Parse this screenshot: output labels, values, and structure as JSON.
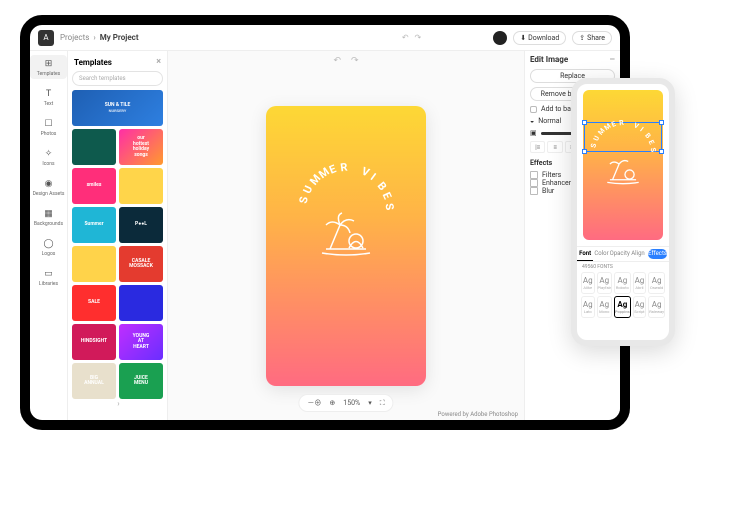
{
  "breadcrumb": {
    "root": "Projects",
    "current": "My Project"
  },
  "toolbar": {
    "download": "Download",
    "share": "Share"
  },
  "rail": [
    {
      "label": "Templates",
      "icon": "⊞",
      "active": true
    },
    {
      "label": "Text",
      "icon": "T"
    },
    {
      "label": "Photos",
      "icon": "☐"
    },
    {
      "label": "Icons",
      "icon": "✧"
    },
    {
      "label": "Design Assets",
      "icon": "◉"
    },
    {
      "label": "Backgrounds",
      "icon": "▦"
    },
    {
      "label": "Logos",
      "icon": "◯"
    },
    {
      "label": "Libraries",
      "icon": "▭"
    }
  ],
  "templates": {
    "title": "Templates",
    "search_placeholder": "Search templates",
    "thumbs": [
      {
        "title": "SUN & TILE",
        "sub": "NURSERY",
        "bg": "linear-gradient(135deg,#1e5fb3,#2e7fe0)",
        "span": 2
      },
      {
        "title": "",
        "bg": "#0e5a4d"
      },
      {
        "title": "our\\nhottest\\nholiday\\nsongs",
        "bg": "linear-gradient(135deg,#ff2ea6,#ff9a2e)"
      },
      {
        "title": "smiles",
        "bg": "#ff2e7a"
      },
      {
        "title": "",
        "bg": "#ffd54a"
      },
      {
        "title": "Summer",
        "bg": "#1fb6d6"
      },
      {
        "title": "P●●L",
        "bg": "#0b2a3a"
      },
      {
        "title": "",
        "bg": "#ffd34a"
      },
      {
        "title": "CASALE\\nMOSSACK",
        "bg": "#e43b2f"
      },
      {
        "title": "SALE",
        "bg": "#ff2e2e"
      },
      {
        "title": "",
        "bg": "#2a2ae0"
      },
      {
        "title": "HINDSIGHT",
        "bg": "#d11a5a"
      },
      {
        "title": "YOUNG\\nAT\\nHEART",
        "bg": "linear-gradient(135deg,#c02eff,#6a2eff)"
      },
      {
        "title": "BIG\\nANNUAL",
        "bg": "#e8e0cc"
      },
      {
        "title": "JUICE\\nMENU",
        "bg": "#1aa051"
      }
    ]
  },
  "canvas": {
    "text": "SUMMER VIBES",
    "zoom": "150%",
    "powered": "Powered by Adobe Photoshop"
  },
  "inspector": {
    "title": "Edit Image",
    "replace": "Replace",
    "removebg": "Remove background",
    "add_bg": "Add to background",
    "blend": "Normal",
    "opacity": "100",
    "effects": "Effects",
    "items": [
      "Filters",
      "Enhancements",
      "Blur"
    ]
  },
  "phone": {
    "tabs": [
      "Font",
      "Color",
      "Opacity",
      "Align",
      "Effects"
    ],
    "active_tab": 0,
    "count": "49560 FONTS",
    "fonts": [
      {
        "g": "Ag",
        "n": "Alike"
      },
      {
        "g": "Ag",
        "n": "Playfair"
      },
      {
        "g": "Ag",
        "n": "Roboto"
      },
      {
        "g": "Ag",
        "n": "Abril"
      },
      {
        "g": "Ag",
        "n": "Oswald"
      },
      {
        "g": "Ag",
        "n": "Lato"
      },
      {
        "g": "Ag",
        "n": "Mono"
      },
      {
        "g": "Ag",
        "n": "Poppins"
      },
      {
        "g": "Ag",
        "n": "Script"
      },
      {
        "g": "Ag",
        "n": "Raleway"
      }
    ],
    "selected_font": 7
  }
}
